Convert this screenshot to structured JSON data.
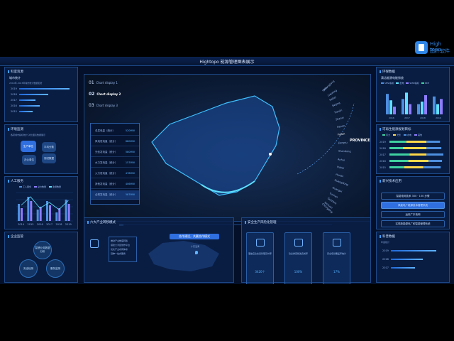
{
  "header": {
    "title": "Hightopo 能源管理图表展示"
  },
  "logo": {
    "en": "High topo",
    "cn": "图扑软件"
  },
  "left": {
    "p1": {
      "title": "科室资源",
      "sub": "城市统计",
      "caption": "2019年-2023年城市统计数据走势",
      "rows": [
        {
          "year": "2019",
          "frac": 0.95
        },
        {
          "year": "2018",
          "frac": 0.55
        },
        {
          "year": "2017",
          "frac": 0.3
        },
        {
          "year": "2016",
          "frac": 0.38
        },
        {
          "year": "2015",
          "frac": 0.25
        }
      ]
    },
    "p2": {
      "title": "环境监测",
      "caption": "各项城市指标统计·对比图表数据展示",
      "bubbles": [
        "生产单位",
        "平均分数",
        "办公单位",
        "测试数据"
      ]
    },
    "p3": {
      "title": "人工服务",
      "legend": [
        "工人服务",
        "总价数量",
        "监测数量"
      ],
      "chart_data": {
        "type": "bar",
        "categories": [
          "2014",
          "2015",
          "2016",
          "2017",
          "2018",
          "2019"
        ],
        "series": [
          {
            "values": [
              60,
              85,
              40,
              70,
              30,
              75
            ]
          },
          {
            "values": [
              45,
              70,
              50,
              55,
              45,
              60
            ]
          }
        ],
        "line": [
          55,
          85,
          45,
          65,
          40,
          72
        ],
        "ylim": [
          0,
          100
        ]
      }
    },
    "p4": {
      "title": "企业监管",
      "circles": [
        "智慧业务数据分析",
        "安全检测",
        "服务监测"
      ]
    }
  },
  "map": {
    "tabs": [
      {
        "n": "01",
        "label": "Chart display 1"
      },
      {
        "n": "02",
        "label": "Chart display 2"
      },
      {
        "n": "03",
        "label": "Chart display 3"
      }
    ],
    "table": [
      {
        "label": "总发电量（统计）",
        "value": "520MW"
      },
      {
        "label": "风电发电量（统计）",
        "value": "680MW"
      },
      {
        "label": "光伏发电量（统计）",
        "value": "580MW"
      },
      {
        "label": "水力发电量（统计）",
        "value": "157MW"
      },
      {
        "label": "火力发电量（统计）",
        "value": "478MW"
      },
      {
        "label": "其他发电量（统计）",
        "value": "406MW"
      },
      {
        "label": "合规发电量（统计）",
        "value": "587MW"
      }
    ],
    "provinces": [
      "Heilongjiang",
      "Jilin",
      "Liaoning",
      "Hebei",
      "Beijing",
      "Tianjin",
      "Shanxi",
      "Henan",
      "Fujian",
      "Jiangsu",
      "Shandong",
      "Anhui",
      "Hubei",
      "Hunan",
      "Guangdong",
      "Guangxi",
      "Yunnan",
      "Guizhou",
      "Sichuan",
      "Chongqing"
    ],
    "province_label": "PROVINCE"
  },
  "bottom": {
    "b1": {
      "title": "六大产业转移模式",
      "desc": [
        "推动产业梯度转移",
        "搭建大湾区协作平台",
        "优化产业布局体系",
        "延伸一站式服务"
      ],
      "button": "合作建设，共赢合作模式",
      "region": "广东沿海"
    },
    "b2": {
      "title": "安全生产风险化管理",
      "cards": [
        {
          "t": "事故应急处置管理及时率",
          "v": "3420个"
        },
        {
          "t": "隐患排查整改完成率",
          "v": "100%"
        },
        {
          "t": "安全培训覆盖率统计",
          "v": "17%"
        }
      ]
    }
  },
  "right": {
    "r1": {
      "title": "环保数据",
      "sub": "清洁能源电能排放",
      "legend": [
        "SMW指标",
        "配电",
        "SMW指标",
        "PRH"
      ],
      "chart_data": {
        "type": "bar",
        "categories": [
          "2016",
          "2017",
          "2018",
          "2019"
        ],
        "series": [
          {
            "values": [
              80,
              60,
              40,
              70
            ]
          },
          {
            "values": [
              55,
              85,
              50,
              40
            ]
          },
          {
            "values": [
              30,
              40,
              75,
              60
            ]
          }
        ],
        "ylim": [
          0,
          100
        ]
      }
    },
    "r2": {
      "title": "可再生能源规划目标",
      "legend": [
        "风力",
        "光伏",
        "水电",
        "其他"
      ],
      "chart_data": {
        "type": "bar",
        "categories": [
          "2019",
          "2018",
          "2017",
          "2016",
          "2015"
        ],
        "series": [
          {
            "values": [
              25,
              20,
              30,
              28,
              22
            ]
          },
          {
            "values": [
              30,
              35,
              25,
              30,
              28
            ]
          },
          {
            "values": [
              20,
              22,
              25,
              20,
              26
            ]
          }
        ],
        "stacked": true
      }
    },
    "r3": {
      "title": "新兴技术应用",
      "items": [
        "智能电网技术 300 · 150 步骤",
        "风能电厂能源技术管理系统",
        "运用广东电网",
        "实现新能源电厂和智能管理系统"
      ]
    },
    "r4": {
      "title": "科普数据",
      "sub": "年度统计",
      "rows": [
        {
          "year": "2019",
          "frac": 0.85
        },
        {
          "year": "2018",
          "frac": 0.6
        },
        {
          "year": "2017",
          "frac": 0.45
        }
      ]
    }
  }
}
